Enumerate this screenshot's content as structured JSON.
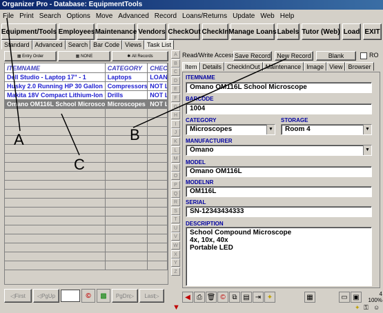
{
  "window": {
    "title": "Organizer Pro - Database: EquipmentTools"
  },
  "menu": [
    "File",
    "Print",
    "Search",
    "Options",
    "Move",
    "Advanced",
    "Record",
    "Loans/Returns",
    "Update",
    "Web",
    "Help"
  ],
  "toolbar": [
    "Equipment/Tools",
    "Employees",
    "Maintenance",
    "Vendors",
    "CheckOut",
    "CheckIn",
    "Manage Loans",
    "Labels",
    "Tutor (Web)",
    "Load",
    "EXIT"
  ],
  "left_tabs": [
    "Standard",
    "Advanced",
    "Search",
    "Bar Code",
    "Views",
    "Task List"
  ],
  "left_tabs_active": "Task List",
  "subtools": [
    "Entry Order",
    "NONE",
    "All Records"
  ],
  "grid": {
    "headers": [
      "ITEMNAME",
      "CATEGORY",
      "CHECK"
    ],
    "rows": [
      [
        "Dell Studio - Laptop 17\" - 1",
        "Laptops",
        "LOAN"
      ],
      [
        "Husky 2.0 Running HP 30 Gallon",
        "Compressors",
        "NOT L"
      ],
      [
        "Makita 18V Compact Lithium-Ion",
        "Drills",
        "NOT L"
      ],
      [
        "Omano OM116L  School Microsco",
        "Microscopes",
        "NOT L"
      ]
    ],
    "selected_row": 3
  },
  "nav": {
    "first": "First",
    "pgup": "PgUp",
    "pgdn": "PgDn",
    "last": "Last"
  },
  "alpha_index": [
    "A",
    "B",
    "C",
    "D",
    "E",
    "F",
    "G",
    "H",
    "I",
    "J",
    "K",
    "L",
    "M",
    "N",
    "O",
    "P",
    "Q",
    "R",
    "S",
    "T",
    "U",
    "V",
    "W",
    "X",
    "Y",
    "Z"
  ],
  "record_bar": {
    "access_label": "Read/Write Access",
    "save": "Save Record",
    "new": "New Record",
    "blank": "Blank",
    "ro": "RO"
  },
  "right_tabs": [
    "Item",
    "Details",
    "CheckInOut",
    "Maintenance",
    "Image",
    "View",
    "Browser"
  ],
  "right_tabs_active": "Item",
  "form": {
    "itemname_label": "ITEMNAME",
    "itemname": "Omano OM116L  School Microscope",
    "barcode_label": "BARCODE",
    "barcode": "1004",
    "category_label": "CATEGORY",
    "category": "Microscopes",
    "storage_label": "STORAGE",
    "storage": "Room 4",
    "manufacturer_label": "MANUFACTURER",
    "manufacturer": "Omano",
    "model_label": "MODEL",
    "model": "Omano OM116L",
    "modelnr_label": "MODELNR",
    "modelnr": "OM116L",
    "serial_label": "SERIAL",
    "serial": "SN-12343434333",
    "description_label": "DESCRIPTION",
    "description": "School Compound Microscope\n4x, 10x, 40x\nPortable LED"
  },
  "status": {
    "count": "4",
    "zoom": "100%"
  },
  "callouts": {
    "a": "A",
    "b": "B",
    "c": "C"
  },
  "colors": {
    "title_start": "#0a246a",
    "title_end": "#3a6ea5",
    "link_blue": "#2020d0",
    "label_blue": "#0000a0",
    "selected_row": "#808080"
  }
}
